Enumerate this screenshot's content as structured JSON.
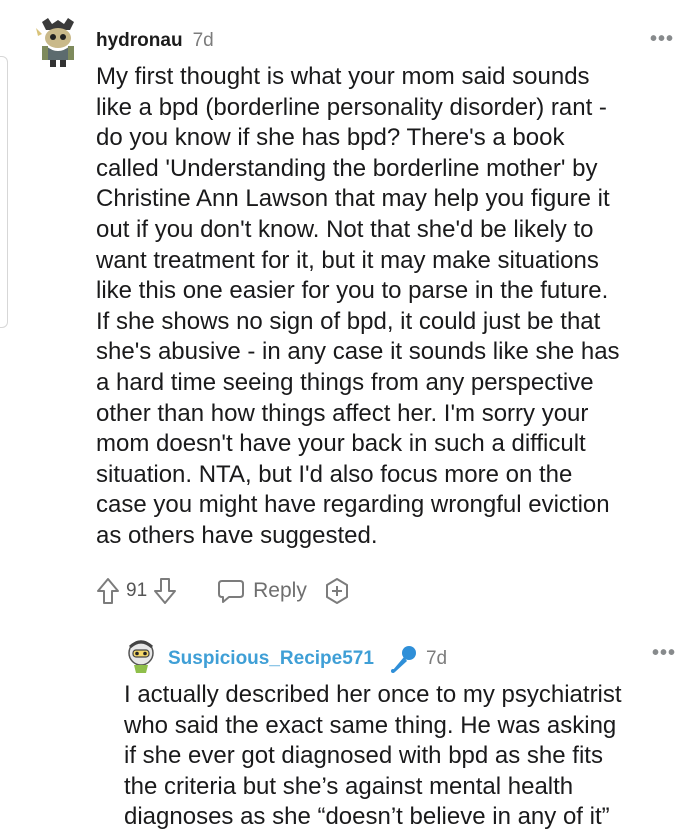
{
  "comment": {
    "author": "hydronau",
    "time": "7d",
    "more_label": "•••",
    "lines": [
      "My first thought is what your mom said sounds",
      "like a bpd (borderline personality disorder) rant -",
      "do you know if she has bpd? There's a book",
      "called 'Understanding the borderline mother' by",
      "Christine Ann Lawson that may help you figure it",
      "out if you don't know. Not that she'd be likely to",
      "want treatment for it, but it may make situations",
      "like this one easier for you to parse in the future.",
      "If she shows no sign of bpd, it could just be that",
      "she's abusive - in any case it sounds like she has",
      "a hard time seeing things from any perspective",
      "other than how things affect her. I'm sorry your",
      "mom doesn't have your back in such a difficult",
      "situation. NTA, but I'd also focus more on the",
      "case you might have regarding wrongful eviction",
      "as others have suggested."
    ],
    "score": "91",
    "reply_label": "Reply",
    "icons": {
      "upvote": "arrow-up-icon",
      "downvote": "arrow-down-icon",
      "reply": "chat-bubble-icon",
      "award": "plus-badge-icon"
    }
  },
  "reply": {
    "author": "Suspicious_Recipe571",
    "time": "7d",
    "more_label": "•••",
    "flair_icon": "microphone-icon",
    "lines": [
      "I actually described her once to my psychiatrist",
      "who said the exact same thing. He was asking",
      "if she ever got diagnosed with bpd as she fits",
      "the criteria but she’s against mental health",
      "diagnoses as she “doesn’t believe in any of it”"
    ]
  },
  "colors": {
    "text": "#1a1a1b",
    "muted": "#7c7c7c",
    "reply_author": "#3f9fd6",
    "mic_blue": "#2f8fd8"
  }
}
